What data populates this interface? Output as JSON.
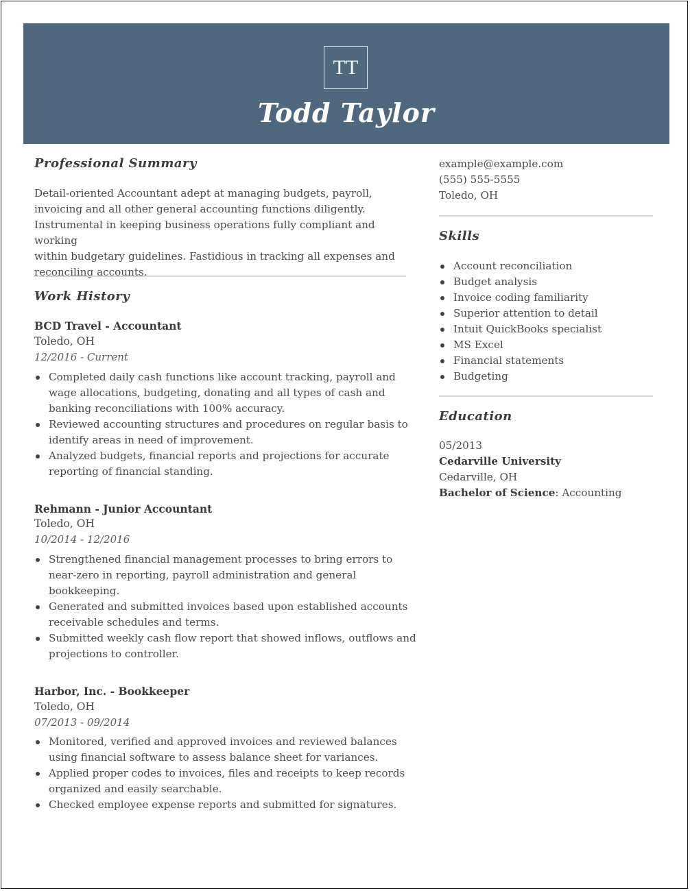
{
  "header": {
    "monogram": "TT",
    "name": "Todd Taylor",
    "background_color": "#4f687d"
  },
  "summary": {
    "title": "Professional Summary",
    "lines": [
      "Detail-oriented Accountant adept at managing budgets, payroll,",
      "invoicing and all other general accounting functions diligently.",
      "Instrumental in keeping business operations fully compliant and working",
      "within budgetary guidelines. Fastidious in tracking all expenses and",
      "reconciling accounts."
    ]
  },
  "work_history": {
    "title": "Work History",
    "jobs": [
      {
        "title": "BCD Travel - Accountant",
        "location": "Toledo, OH",
        "dates": "12/2016 - Current",
        "bullets": [
          [
            "Completed daily cash functions like account tracking, payroll and",
            "wage allocations, budgeting, donating and all types of cash and",
            "banking reconciliations with 100% accuracy."
          ],
          [
            "Reviewed accounting structures and procedures on regular basis to",
            "identify areas in need of improvement."
          ],
          [
            "Analyzed budgets, financial reports and projections for accurate",
            "reporting of financial standing."
          ]
        ]
      },
      {
        "title": "Rehmann - Junior Accountant",
        "location": "Toledo, OH",
        "dates": "10/2014 - 12/2016",
        "bullets": [
          [
            "Strengthened financial management processes to bring errors to",
            "near-zero in reporting, payroll administration and general",
            "bookkeeping."
          ],
          [
            "Generated and submitted invoices based upon established accounts",
            "receivable schedules and terms."
          ],
          [
            "Submitted weekly cash flow report that showed inflows, outflows and",
            "projections to controller."
          ]
        ]
      },
      {
        "title": "Harbor, Inc. - Bookkeeper",
        "location": "Toledo, OH",
        "dates": "07/2013 - 09/2014",
        "bullets": [
          [
            "Monitored, verified and approved invoices and reviewed balances",
            "using financial software to assess balance sheet for variances."
          ],
          [
            "Applied proper codes to invoices, files and receipts to keep records",
            "organized and easily searchable."
          ],
          [
            "Checked employee expense reports and submitted for signatures."
          ]
        ]
      }
    ]
  },
  "contact": {
    "email": "example@example.com",
    "phone": "(555) 555-5555",
    "location": "Toledo, OH"
  },
  "skills": {
    "title": "Skills",
    "items": [
      "Account reconciliation",
      "Budget analysis",
      "Invoice coding familiarity",
      "Superior attention to detail",
      "Intuit QuickBooks specialist",
      "MS Excel",
      "Financial statements",
      "Budgeting"
    ]
  },
  "education": {
    "title": "Education",
    "date": "05/2013",
    "school": "Cedarville University",
    "location": "Cedarville, OH",
    "degree_label": "Bachelor of Science",
    "degree_separator": ":",
    "field": " Accounting"
  }
}
